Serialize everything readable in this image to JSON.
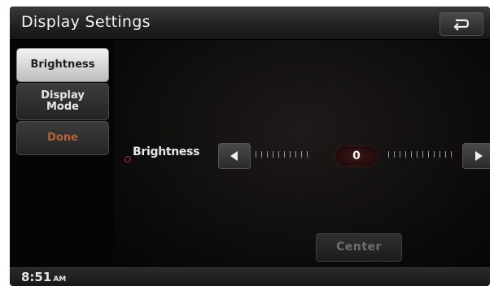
{
  "header": {
    "title": "Display Settings",
    "back_icon": "return-arrow-icon"
  },
  "sidebar": {
    "items": [
      {
        "label": "Brightness",
        "state": "selected"
      },
      {
        "label_line1": "Display",
        "label_line2": "Mode",
        "state": "normal"
      },
      {
        "label": "Done",
        "state": "disabled"
      }
    ]
  },
  "main": {
    "setting_label": "Brightness",
    "value": "0",
    "decrease_icon": "triangle-left-icon",
    "increase_icon": "triangle-right-icon",
    "center_label": "Center"
  },
  "status": {
    "time": "8:51",
    "ampm": "AM"
  },
  "colors": {
    "background": "#050505",
    "done_text": "#b8613a",
    "accent_bullet": "#b0302a"
  }
}
